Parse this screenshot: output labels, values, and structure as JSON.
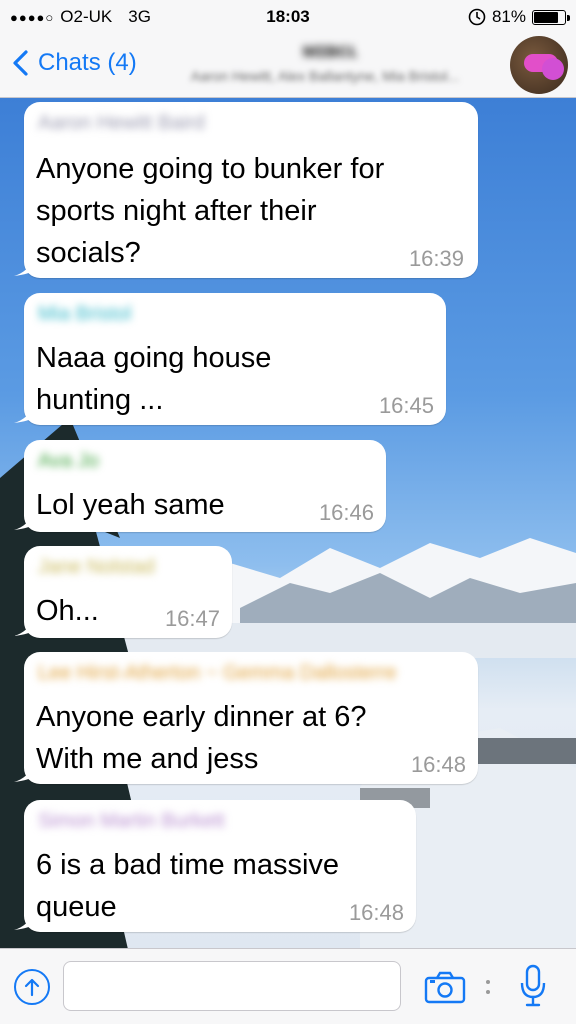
{
  "status_bar": {
    "signal": "●●●●○",
    "carrier": "O2-UK",
    "network": "3G",
    "time": "18:03",
    "battery_percent": "81%",
    "battery_level": 0.81
  },
  "nav": {
    "back_label": "Chats (4)",
    "title": "ᴍɪʙᴄʟ",
    "subtitle": "Aaron Hewitt, Alex Ballantyne, Mia Bristol..."
  },
  "messages": [
    {
      "sender": "Aaron Hewitt Baird",
      "sender_color": "#9a9ab0",
      "text": "Anyone going to bunker for\nsports night after their\nsocials?",
      "time": "16:39"
    },
    {
      "sender": "Mia Bristol",
      "sender_color": "#35b8c9",
      "text": "Naaa going house\nhunting ...",
      "time": "16:45"
    },
    {
      "sender": "Ava Jo",
      "sender_color": "#3fa43f",
      "text": "Lol yeah same",
      "time": "16:46"
    },
    {
      "sender": "Jane Nolstad",
      "sender_color": "#c9b95a",
      "text": "Oh...",
      "time": "16:47"
    },
    {
      "sender": "Lee Hirst-Atherton          ~ Gemma Dallosterre",
      "sender_color": "#e0a13a",
      "text": "Anyone early dinner at 6?\nWith me and jess",
      "time": "16:48"
    },
    {
      "sender": "Simon Martin Burkett",
      "sender_color": "#b88fd0",
      "text": "6 is a bad time massive\nqueue",
      "time": "16:48"
    }
  ],
  "input_bar": {
    "placeholder": ""
  },
  "colors": {
    "accent": "#1479f5"
  },
  "icons": [
    "back-chevron-icon",
    "upload-icon",
    "camera-icon",
    "microphone-icon",
    "alarm-lock-icon",
    "battery-icon"
  ]
}
